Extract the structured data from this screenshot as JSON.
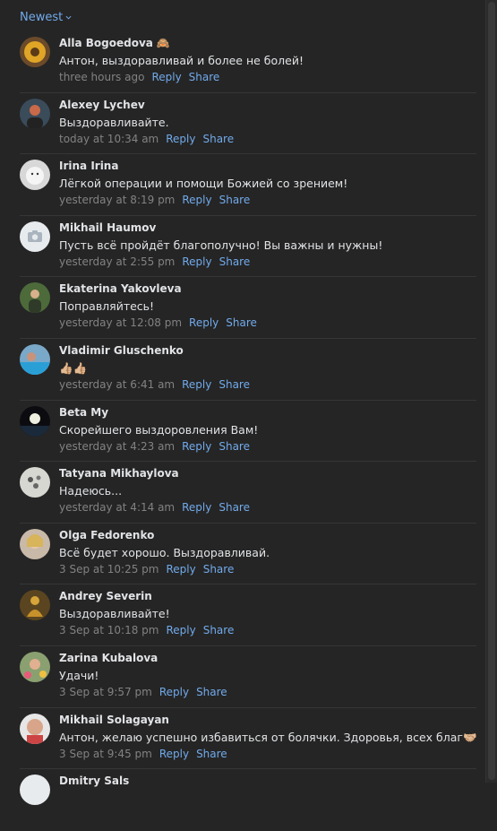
{
  "sort": {
    "label": "Newest"
  },
  "comments": [
    {
      "name": "Alla Bogoedova",
      "emoji": "🙈",
      "text": "Антон, выздоравливай и более не болей!",
      "time": "three hours ago",
      "reply": "Reply",
      "share": "Share",
      "avatar": "sunflower"
    },
    {
      "name": "Alexey Lychev",
      "text": "Выздоравливайте.",
      "time": "today at 10:34 am",
      "reply": "Reply",
      "share": "Share",
      "avatar": "person-dark"
    },
    {
      "name": "Irina Irina",
      "text": "Лёгкой операции и помощи Божией со зрением!",
      "time": "yesterday at 8:19 pm",
      "reply": "Reply",
      "share": "Share",
      "avatar": "white-cat"
    },
    {
      "name": "Mikhail Haumov",
      "text": "Пусть всё пройдёт благополучно! Вы важны и нужны!",
      "time": "yesterday at 2:55 pm",
      "reply": "Reply",
      "share": "Share",
      "avatar": "camera"
    },
    {
      "name": "Ekaterina Yakovleva",
      "text": "Поправляйтесь!",
      "time": "yesterday at 12:08 pm",
      "reply": "Reply",
      "share": "Share",
      "avatar": "woman-green"
    },
    {
      "name": "Vladimir Gluschenko",
      "text": "👍🏼👍🏼",
      "time": "yesterday at 6:41 am",
      "reply": "Reply",
      "share": "Share",
      "avatar": "pool"
    },
    {
      "name": "Beta My",
      "text": "Скорейшего выздоровления Вам!",
      "time": "yesterday at 4:23 am",
      "reply": "Reply",
      "share": "Share",
      "avatar": "moon"
    },
    {
      "name": "Tatyana Mikhaylova",
      "text": "Надеюсь...",
      "time": "yesterday at 4:14 am",
      "reply": "Reply",
      "share": "Share",
      "avatar": "flowers"
    },
    {
      "name": "Olga Fedorenko",
      "text": "Всё будет хорошо. Выздоравливай.",
      "time": "3 Sep at 10:25 pm",
      "reply": "Reply",
      "share": "Share",
      "avatar": "woman-blonde"
    },
    {
      "name": "Andrey Severin",
      "text": "Выздоравливайте!",
      "time": "3 Sep at 10:18 pm",
      "reply": "Reply",
      "share": "Share",
      "avatar": "buddha"
    },
    {
      "name": "Zarina Kubalova",
      "text": "Удачи!",
      "time": "3 Sep at 9:57 pm",
      "reply": "Reply",
      "share": "Share",
      "avatar": "woman-flowers"
    },
    {
      "name": "Mikhail Solagayan",
      "text": "Антон, желаю успешно избавиться от болячки. Здоровья, всех благ🤝🏼",
      "time": "3 Sep at 9:45 pm",
      "reply": "Reply",
      "share": "Share",
      "avatar": "man-bald"
    },
    {
      "name": "Dmitry Sals",
      "text": "",
      "time": "",
      "reply": "",
      "share": "",
      "avatar": "generic"
    }
  ]
}
